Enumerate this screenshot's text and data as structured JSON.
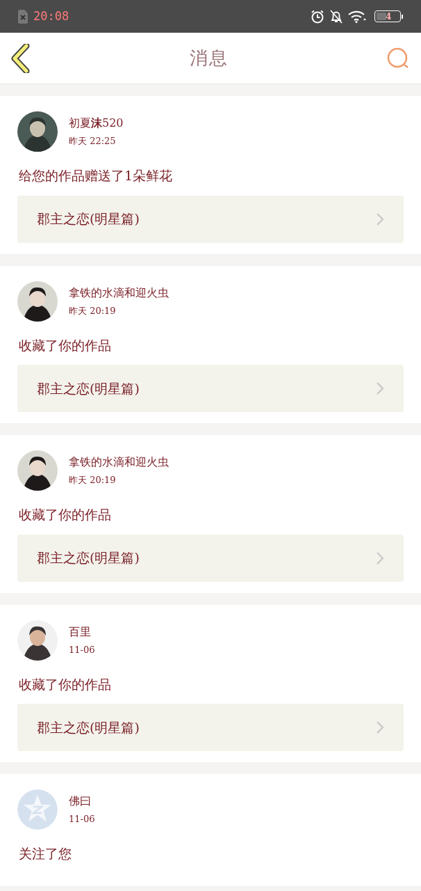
{
  "status_bar": {
    "time": "20:08",
    "battery": "4"
  },
  "header": {
    "title": "消息"
  },
  "messages": [
    {
      "name": "初夏**沫**520",
      "time": "昨天 22:25",
      "action": "给您的作品赠送了1朵鲜花",
      "work": "郡主之恋(明星篇)"
    },
    {
      "name": "拿铁的水滴和迎火虫",
      "time": "昨天 20:19",
      "action": "收藏了你的作品",
      "work": "郡主之恋(明星篇)"
    },
    {
      "name": "拿铁的水滴和迎火虫",
      "time": "昨天 20:19",
      "action": "收藏了你的作品",
      "work": "郡主之恋(明星篇)"
    },
    {
      "name": "百里",
      "time": "11-06",
      "action": "收藏了你的作品",
      "work": "郡主之恋(明星篇)"
    },
    {
      "avatar": {
        "kind": "default"
      },
      "name": "佛曰",
      "time": "11-06",
      "action": "关注了您"
    }
  ]
}
